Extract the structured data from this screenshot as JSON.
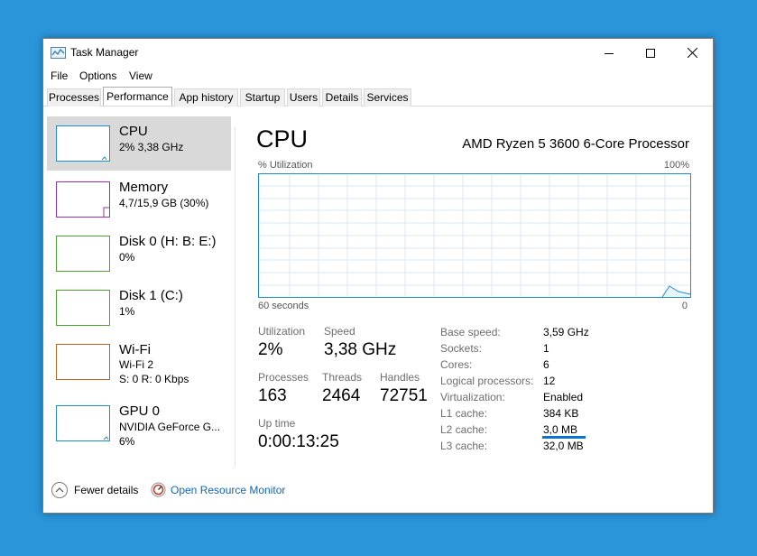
{
  "window": {
    "title": "Task Manager"
  },
  "icons": {
    "app": "task-manager-icon",
    "minimize": "minimize-icon",
    "maximize": "maximize-icon",
    "close": "close-icon",
    "fewer": "chevron-up-circle-icon",
    "monitor": "resource-monitor-icon"
  },
  "menu": [
    "File",
    "Options",
    "View"
  ],
  "tabs": [
    "Processes",
    "Performance",
    "App history",
    "Startup",
    "Users",
    "Details",
    "Services"
  ],
  "active_tab": "Performance",
  "sidebar": [
    {
      "title": "CPU",
      "sub1": "2% 3,38 GHz",
      "sub2": "",
      "color": "#1f8ec5"
    },
    {
      "title": "Memory",
      "sub1": "4,7/15,9 GB (30%)",
      "sub2": "",
      "color": "#9b2fae"
    },
    {
      "title": "Disk 0 (H: B: E:)",
      "sub1": "0%",
      "sub2": "",
      "color": "#4ca32e"
    },
    {
      "title": "Disk 1 (C:)",
      "sub1": "1%",
      "sub2": "",
      "color": "#4ca32e"
    },
    {
      "title": "Wi-Fi",
      "sub1": "Wi-Fi 2",
      "sub2": "S: 0 R: 0 Kbps",
      "color": "#b8661c"
    },
    {
      "title": "GPU 0",
      "sub1": "NVIDIA GeForce G...",
      "sub2": "6%",
      "color": "#1f8ec5"
    }
  ],
  "main": {
    "title": "CPU",
    "processor": "AMD Ryzen 5 3600 6-Core Processor",
    "graph_label": "% Utilization",
    "graph_max": "100%",
    "graph_time": "60 seconds",
    "graph_min": "0",
    "stats": {
      "utilization_label": "Utilization",
      "utilization": "2%",
      "speed_label": "Speed",
      "speed": "3,38 GHz",
      "processes_label": "Processes",
      "processes": "163",
      "threads_label": "Threads",
      "threads": "2464",
      "handles_label": "Handles",
      "handles": "72751",
      "uptime_label": "Up time",
      "uptime": "0:00:13:25"
    },
    "specs": [
      {
        "label": "Base speed:",
        "value": "3,59 GHz"
      },
      {
        "label": "Sockets:",
        "value": "1"
      },
      {
        "label": "Cores:",
        "value": "6"
      },
      {
        "label": "Logical processors:",
        "value": "12"
      },
      {
        "label": "Virtualization:",
        "value": "Enabled"
      },
      {
        "label": "L1 cache:",
        "value": "384 KB"
      },
      {
        "label": "L2 cache:",
        "value": "3,0 MB"
      },
      {
        "label": "L3 cache:",
        "value": "32,0 MB"
      }
    ]
  },
  "footer": {
    "fewer": "Fewer details",
    "monitor": "Open Resource Monitor"
  },
  "colors": {
    "desktop": "#2b95d9",
    "accent": "#0b73d1",
    "graph_line": "#1f8ec5",
    "grid": "#d9eaf4"
  }
}
